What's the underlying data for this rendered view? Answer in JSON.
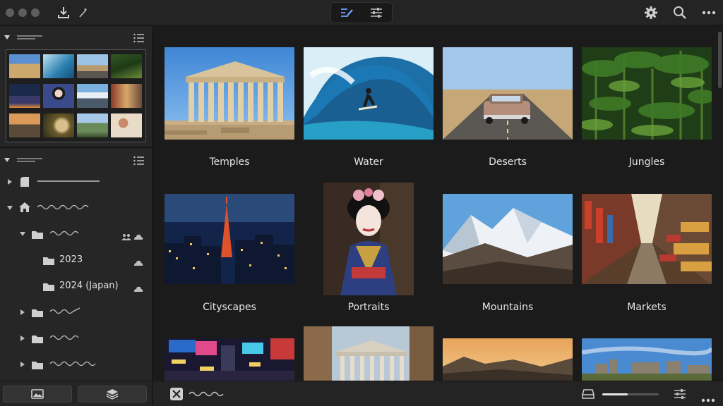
{
  "window": {
    "controls": [
      "close",
      "minimize",
      "maximize"
    ]
  },
  "toolbar": {
    "left_icons": [
      "import-icon",
      "magic-icon"
    ],
    "modes": [
      {
        "name": "edit-mode",
        "icon": "pencil-lines-icon",
        "active": true
      },
      {
        "name": "adjust-mode",
        "icon": "sliders-icon",
        "active": false
      }
    ],
    "right_icons": [
      "gear-icon",
      "search-icon",
      "more-icon"
    ]
  },
  "sidebar": {
    "folders": [
      {
        "label": "2023",
        "icon": "folder-icon",
        "cloud": true
      },
      {
        "label": "2024 (Japan)",
        "icon": "folder-icon",
        "cloud": true
      }
    ],
    "bottom_buttons": [
      "photos-icon",
      "layers-icon"
    ]
  },
  "grid": {
    "albums": [
      {
        "label": "Temples"
      },
      {
        "label": "Water"
      },
      {
        "label": "Deserts"
      },
      {
        "label": "Jungles"
      },
      {
        "label": "Cityscapes"
      },
      {
        "label": "Portraits"
      },
      {
        "label": "Mountains"
      },
      {
        "label": "Markets"
      }
    ]
  },
  "bottombar": {
    "zoom_fraction": 0.45
  },
  "colors": {
    "background": "#1b1b1b",
    "panel": "#262626",
    "text": "#e6e6e6",
    "accent": "#d8d8d8"
  }
}
